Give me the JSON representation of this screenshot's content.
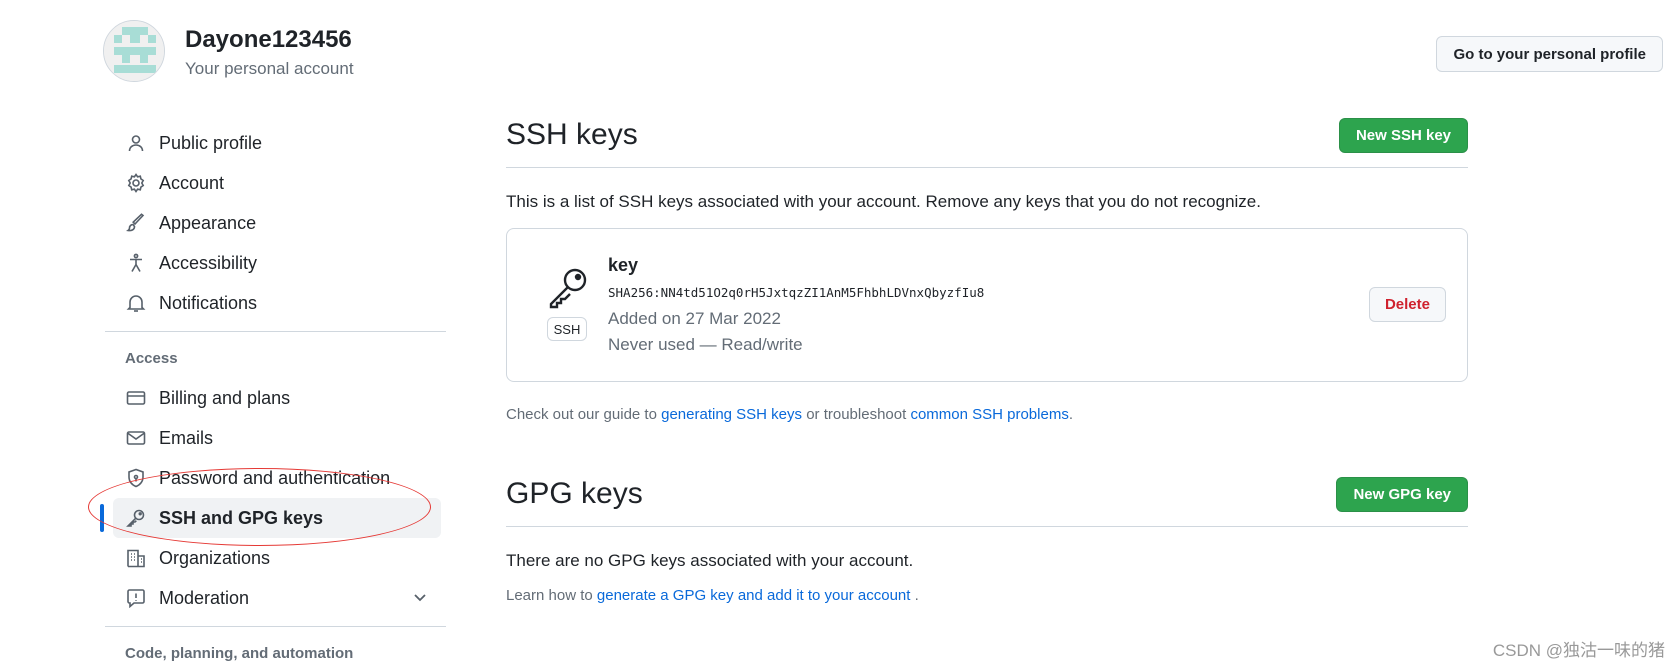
{
  "header": {
    "username": "Dayone123456",
    "subtitle": "Your personal account",
    "profile_button": "Go to your personal profile"
  },
  "sidebar": {
    "items_top": [
      {
        "label": "Public profile",
        "icon": "person-icon"
      },
      {
        "label": "Account",
        "icon": "gear-icon"
      },
      {
        "label": "Appearance",
        "icon": "paintbrush-icon"
      },
      {
        "label": "Accessibility",
        "icon": "accessibility-icon"
      },
      {
        "label": "Notifications",
        "icon": "bell-icon"
      }
    ],
    "access_heading": "Access",
    "items_access": [
      {
        "label": "Billing and plans",
        "icon": "credit-card-icon"
      },
      {
        "label": "Emails",
        "icon": "mail-icon"
      },
      {
        "label": "Password and authentication",
        "icon": "shield-lock-icon"
      },
      {
        "label": "SSH and GPG keys",
        "icon": "key-icon",
        "active": true
      },
      {
        "label": "Organizations",
        "icon": "organization-icon"
      },
      {
        "label": "Moderation",
        "icon": "report-icon"
      }
    ],
    "code_heading": "Code, planning, and automation"
  },
  "ssh": {
    "title": "SSH keys",
    "new_button": "New SSH key",
    "description": "This is a list of SSH keys associated with your account. Remove any keys that you do not recognize.",
    "key": {
      "badge": "SSH",
      "name": "key",
      "fingerprint": "SHA256:NN4td51O2q0rH5JxtqzZI1AnM5FhbhLDVnxQbyzfIu8",
      "added": "Added on 27 Mar 2022",
      "usage": "Never used — Read/write",
      "delete_button": "Delete"
    },
    "note_prefix": "Check out our guide to ",
    "note_link1": "generating SSH keys",
    "note_middle": " or troubleshoot ",
    "note_link2": "common SSH problems",
    "note_suffix": "."
  },
  "gpg": {
    "title": "GPG keys",
    "new_button": "New GPG key",
    "description": "There are no GPG keys associated with your account.",
    "note_prefix": "Learn how to ",
    "note_link": "generate a GPG key and add it to your account",
    "note_suffix": " ."
  },
  "watermark": "CSDN @独沽一味的猪",
  "colors": {
    "accent": "#0969da",
    "green": "#2da44e",
    "danger": "#cf222e",
    "annotation": "#e53935"
  }
}
